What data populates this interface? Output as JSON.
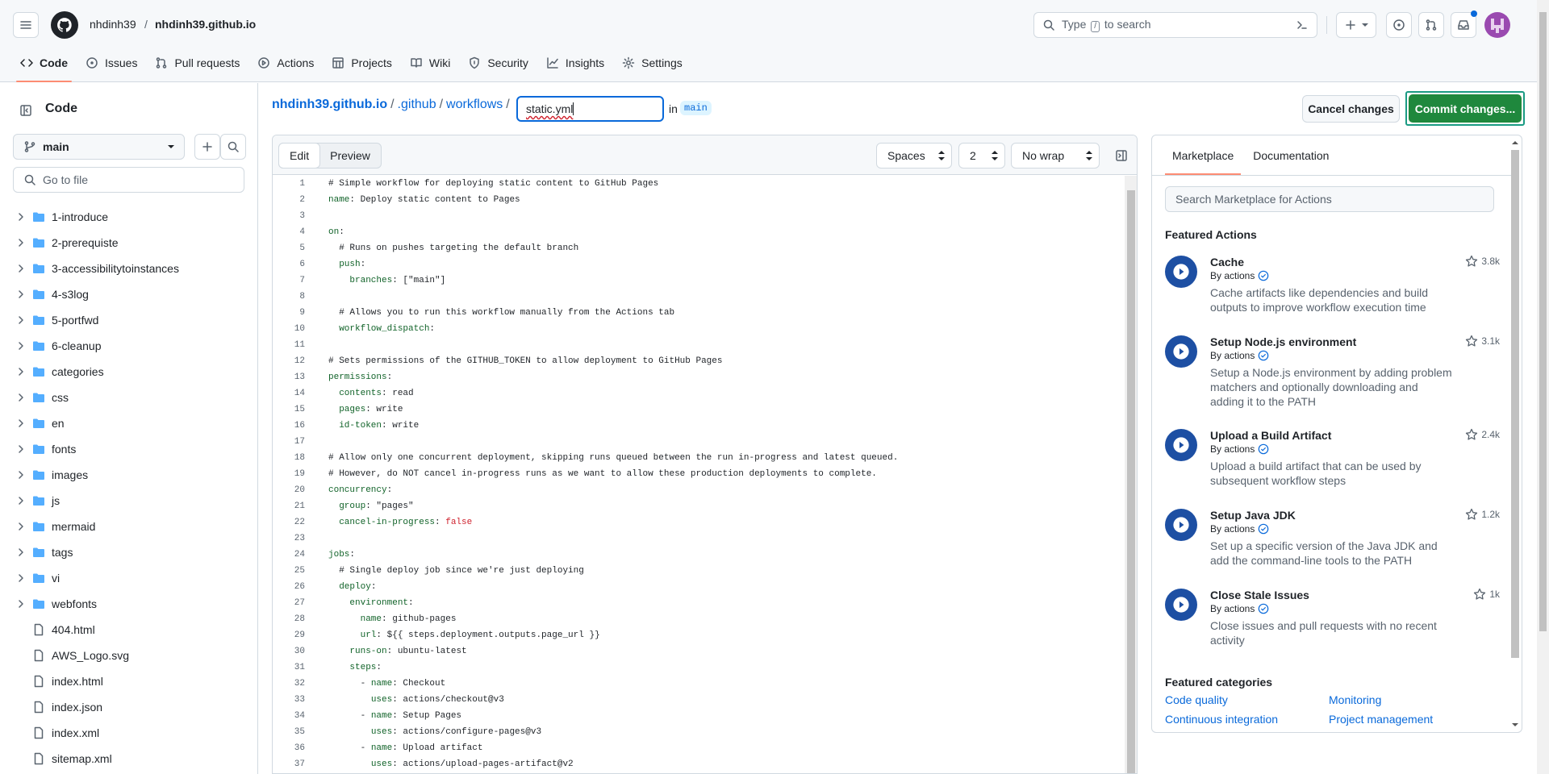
{
  "header": {
    "owner": "nhdinh39",
    "slash": "/",
    "repo": "nhdinh39.github.io",
    "search_placeholder": "Type",
    "search_key": "/",
    "search_suffix": "to search"
  },
  "nav": [
    {
      "label": "Code",
      "icon": "code-icon"
    },
    {
      "label": "Issues",
      "icon": "issue-icon"
    },
    {
      "label": "Pull requests",
      "icon": "pull-request-icon"
    },
    {
      "label": "Actions",
      "icon": "actions-icon"
    },
    {
      "label": "Projects",
      "icon": "projects-icon"
    },
    {
      "label": "Wiki",
      "icon": "book-icon"
    },
    {
      "label": "Security",
      "icon": "shield-icon"
    },
    {
      "label": "Insights",
      "icon": "graph-icon"
    },
    {
      "label": "Settings",
      "icon": "gear-icon"
    }
  ],
  "sidebar": {
    "title": "Code",
    "branch": "main",
    "goto_placeholder": "Go to file",
    "tree": [
      {
        "name": "1-introduce",
        "type": "dir"
      },
      {
        "name": "2-prerequiste",
        "type": "dir"
      },
      {
        "name": "3-accessibilitytoinstances",
        "type": "dir"
      },
      {
        "name": "4-s3log",
        "type": "dir"
      },
      {
        "name": "5-portfwd",
        "type": "dir"
      },
      {
        "name": "6-cleanup",
        "type": "dir"
      },
      {
        "name": "categories",
        "type": "dir"
      },
      {
        "name": "css",
        "type": "dir"
      },
      {
        "name": "en",
        "type": "dir"
      },
      {
        "name": "fonts",
        "type": "dir"
      },
      {
        "name": "images",
        "type": "dir"
      },
      {
        "name": "js",
        "type": "dir"
      },
      {
        "name": "mermaid",
        "type": "dir"
      },
      {
        "name": "tags",
        "type": "dir"
      },
      {
        "name": "vi",
        "type": "dir"
      },
      {
        "name": "webfonts",
        "type": "dir"
      },
      {
        "name": "404.html",
        "type": "file"
      },
      {
        "name": "AWS_Logo.svg",
        "type": "file"
      },
      {
        "name": "index.html",
        "type": "file"
      },
      {
        "name": "index.json",
        "type": "file"
      },
      {
        "name": "index.xml",
        "type": "file"
      },
      {
        "name": "sitemap.xml",
        "type": "file"
      }
    ]
  },
  "breadcrumb": {
    "repo": "nhdinh39.github.io",
    "sep": "/",
    "dir1": ".github",
    "dir2": "workflows",
    "filename": "static.yml",
    "in": "in",
    "branch": "main"
  },
  "buttons": {
    "cancel": "Cancel changes",
    "commit": "Commit changes..."
  },
  "editor": {
    "mode_edit": "Edit",
    "mode_preview": "Preview",
    "indent_mode": "Spaces",
    "indent_size": "2",
    "wrap": "No wrap",
    "lines": [
      [
        [
          "c",
          "# Simple workflow for deploying static content to GitHub Pages"
        ]
      ],
      [
        [
          "k",
          "name"
        ],
        [
          "c",
          ": Deploy static content to Pages"
        ]
      ],
      [],
      [
        [
          "k",
          "on"
        ],
        [
          "c",
          ":"
        ]
      ],
      [
        [
          "c",
          "  # Runs on pushes targeting the default branch"
        ]
      ],
      [
        [
          "c",
          "  "
        ],
        [
          "k",
          "push"
        ],
        [
          "c",
          ":"
        ]
      ],
      [
        [
          "c",
          "    "
        ],
        [
          "k",
          "branches"
        ],
        [
          "c",
          ": [\"main\"]"
        ]
      ],
      [],
      [
        [
          "c",
          "  # Allows you to run this workflow manually from the Actions tab"
        ]
      ],
      [
        [
          "c",
          "  "
        ],
        [
          "k",
          "workflow_dispatch"
        ],
        [
          "c",
          ":"
        ]
      ],
      [],
      [
        [
          "c",
          "# Sets permissions of the GITHUB_TOKEN to allow deployment to GitHub Pages"
        ]
      ],
      [
        [
          "k",
          "permissions"
        ],
        [
          "c",
          ":"
        ]
      ],
      [
        [
          "c",
          "  "
        ],
        [
          "k",
          "contents"
        ],
        [
          "c",
          ": read"
        ]
      ],
      [
        [
          "c",
          "  "
        ],
        [
          "k",
          "pages"
        ],
        [
          "c",
          ": write"
        ]
      ],
      [
        [
          "c",
          "  "
        ],
        [
          "k",
          "id-token"
        ],
        [
          "c",
          ": write"
        ]
      ],
      [],
      [
        [
          "c",
          "# Allow only one concurrent deployment, skipping runs queued between the run in-progress and latest queued."
        ]
      ],
      [
        [
          "c",
          "# However, do NOT cancel in-progress runs as we want to allow these production deployments to complete."
        ]
      ],
      [
        [
          "k",
          "concurrency"
        ],
        [
          "c",
          ":"
        ]
      ],
      [
        [
          "c",
          "  "
        ],
        [
          "k",
          "group"
        ],
        [
          "c",
          ": \"pages\""
        ]
      ],
      [
        [
          "c",
          "  "
        ],
        [
          "k",
          "cancel-in-progress"
        ],
        [
          "c",
          ": "
        ],
        [
          "f",
          "false"
        ]
      ],
      [],
      [
        [
          "k",
          "jobs"
        ],
        [
          "c",
          ":"
        ]
      ],
      [
        [
          "c",
          "  # Single deploy job since we're just deploying"
        ]
      ],
      [
        [
          "c",
          "  "
        ],
        [
          "k",
          "deploy"
        ],
        [
          "c",
          ":"
        ]
      ],
      [
        [
          "c",
          "    "
        ],
        [
          "k",
          "environment"
        ],
        [
          "c",
          ":"
        ]
      ],
      [
        [
          "c",
          "      "
        ],
        [
          "k",
          "name"
        ],
        [
          "c",
          ": github-pages"
        ]
      ],
      [
        [
          "c",
          "      "
        ],
        [
          "k",
          "url"
        ],
        [
          "c",
          ": ${{ steps.deployment.outputs.page_url }}"
        ]
      ],
      [
        [
          "c",
          "    "
        ],
        [
          "k",
          "runs-on"
        ],
        [
          "c",
          ": ubuntu-latest"
        ]
      ],
      [
        [
          "c",
          "    "
        ],
        [
          "k",
          "steps"
        ],
        [
          "c",
          ":"
        ]
      ],
      [
        [
          "c",
          "      - "
        ],
        [
          "k",
          "name"
        ],
        [
          "c",
          ": Checkout"
        ]
      ],
      [
        [
          "c",
          "        "
        ],
        [
          "k",
          "uses"
        ],
        [
          "c",
          ": actions/checkout@v3"
        ]
      ],
      [
        [
          "c",
          "      - "
        ],
        [
          "k",
          "name"
        ],
        [
          "c",
          ": Setup Pages"
        ]
      ],
      [
        [
          "c",
          "        "
        ],
        [
          "k",
          "uses"
        ],
        [
          "c",
          ": actions/configure-pages@v3"
        ]
      ],
      [
        [
          "c",
          "      - "
        ],
        [
          "k",
          "name"
        ],
        [
          "c",
          ": Upload artifact"
        ]
      ],
      [
        [
          "c",
          "        "
        ],
        [
          "k",
          "uses"
        ],
        [
          "c",
          ": actions/upload-pages-artifact@v2"
        ]
      ]
    ]
  },
  "marketplace": {
    "tab1": "Marketplace",
    "tab2": "Documentation",
    "search_placeholder": "Search Marketplace for Actions",
    "featured_title": "Featured Actions",
    "actions": [
      {
        "name": "Cache",
        "by": "By actions",
        "desc": "Cache artifacts like dependencies and build outputs to improve workflow execution time",
        "stars": "3.8k"
      },
      {
        "name": "Setup Node.js environment",
        "by": "By actions",
        "desc": "Setup a Node.js environment by adding problem matchers and optionally downloading and adding it to the PATH",
        "stars": "3.1k"
      },
      {
        "name": "Upload a Build Artifact",
        "by": "By actions",
        "desc": "Upload a build artifact that can be used by subsequent workflow steps",
        "stars": "2.4k"
      },
      {
        "name": "Setup Java JDK",
        "by": "By actions",
        "desc": "Set up a specific version of the Java JDK and add the command-line tools to the PATH",
        "stars": "1.2k"
      },
      {
        "name": "Close Stale Issues",
        "by": "By actions",
        "desc": "Close issues and pull requests with no recent activity",
        "stars": "1k"
      }
    ],
    "categories_title": "Featured categories",
    "categories": [
      "Code quality",
      "Monitoring",
      "Continuous integration",
      "Project management"
    ]
  },
  "colors": {
    "accent": "#0969da",
    "commit_green": "#1f883d",
    "tab_underline": "#fd8c73",
    "action_blue": "#1d4fa3"
  }
}
